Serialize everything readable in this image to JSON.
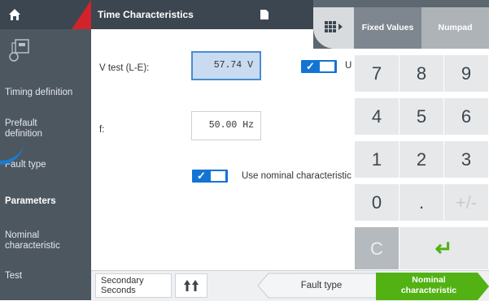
{
  "sidebar": {
    "items": [
      {
        "label": "Timing definition"
      },
      {
        "label": "Prefault definition"
      },
      {
        "label": "Fault type"
      },
      {
        "label": "Parameters"
      },
      {
        "label": "Nominal characteristic"
      },
      {
        "label": "Test"
      }
    ]
  },
  "header": {
    "title": "Time Characteristics"
  },
  "form": {
    "vtest_label": "V test (L-E):",
    "vtest_value": "57.74 V",
    "use_label_partial": "U",
    "f_label": "f:",
    "f_value": "50.00 Hz",
    "nominal_label": "Use nominal characteristic"
  },
  "numpad": {
    "tab_fixed": "Fixed Values",
    "tab_numpad": "Numpad",
    "keys": [
      "7",
      "8",
      "9",
      "4",
      "5",
      "6",
      "1",
      "2",
      "3",
      "0",
      ".",
      "+/-",
      "C",
      "↵"
    ]
  },
  "bottom": {
    "units_line1": "Secondary",
    "units_line2": "Seconds",
    "prev_label": "Fault type",
    "next_label_line1": "Nominal",
    "next_label_line2": "characteristic"
  },
  "colors": {
    "accent_blue": "#1474d4",
    "next_green": "#52b213",
    "sidebar": "#4d5760",
    "home_red": "#d0232c"
  }
}
